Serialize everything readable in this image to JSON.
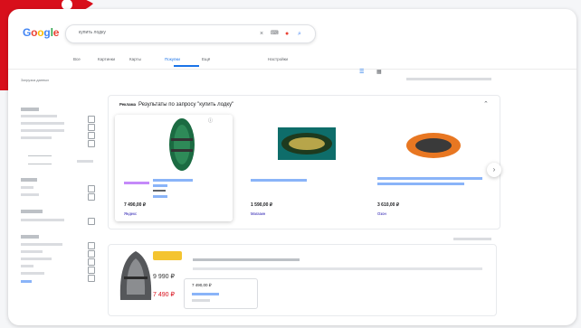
{
  "logo": {
    "text": "Google"
  },
  "search": {
    "query": "купить лодку"
  },
  "tabs": [
    {
      "label": "Все"
    },
    {
      "label": "Картинки"
    },
    {
      "label": "Карты"
    },
    {
      "label": "Покупки"
    },
    {
      "label": "Ещё"
    },
    {
      "label": "Настройки"
    }
  ],
  "sidebar": {
    "note": "Загрузка данных"
  },
  "panel": {
    "ads_label": "Реклама",
    "heading": "Результаты по запросу \"купить лодку\""
  },
  "products": [
    {
      "price": "7 490,00 ₽",
      "seller": "Яндекс"
    },
    {
      "price": "1 590,00 ₽",
      "seller": "Магазин"
    },
    {
      "price": "3 610,00 ₽",
      "seller": "Озон"
    }
  ],
  "promo": {
    "old_price": "9 990 ₽",
    "new_price": "7 490 ₽",
    "box_price": "7 490,00 ₽"
  },
  "colors": {
    "blue": "#4285F4",
    "red": "#EA4335",
    "yellow": "#FBBC05",
    "green": "#34A853",
    "link": "#1a0dab",
    "accent": "#1a73e8",
    "mark": "#d80f1b"
  }
}
